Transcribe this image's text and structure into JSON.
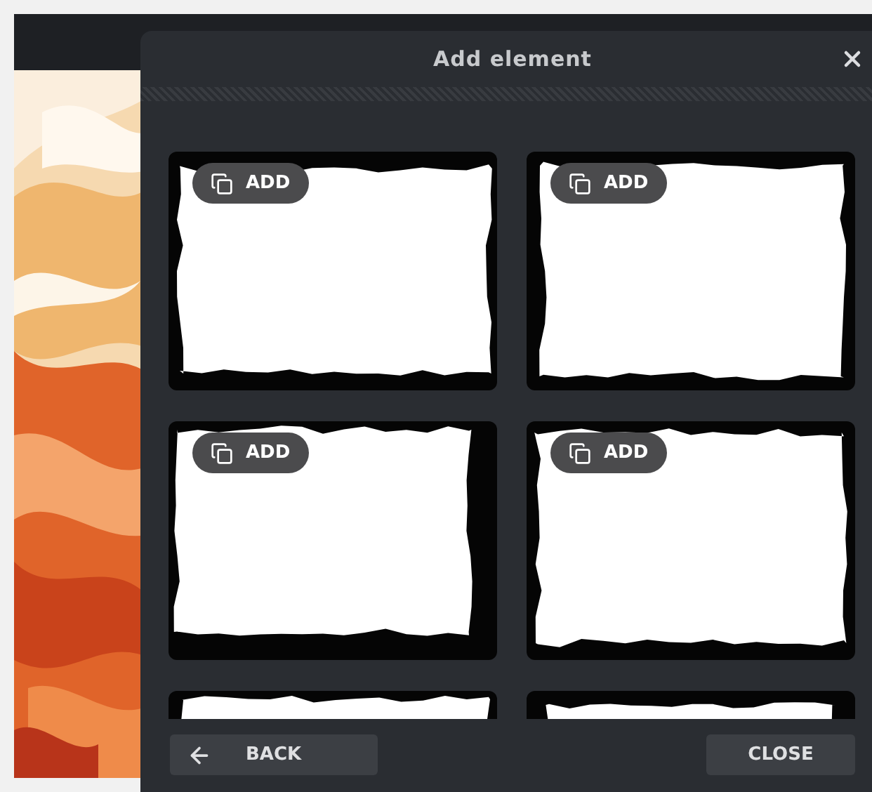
{
  "dialog": {
    "title": "Add element"
  },
  "tiles": [
    {
      "kind": "full",
      "add_label": "ADD"
    },
    {
      "kind": "full",
      "add_label": "ADD"
    },
    {
      "kind": "full",
      "add_label": "ADD"
    },
    {
      "kind": "full",
      "add_label": "ADD"
    },
    {
      "kind": "cut"
    },
    {
      "kind": "cut"
    }
  ],
  "footer": {
    "back_label": "BACK",
    "close_label": "CLOSE"
  }
}
